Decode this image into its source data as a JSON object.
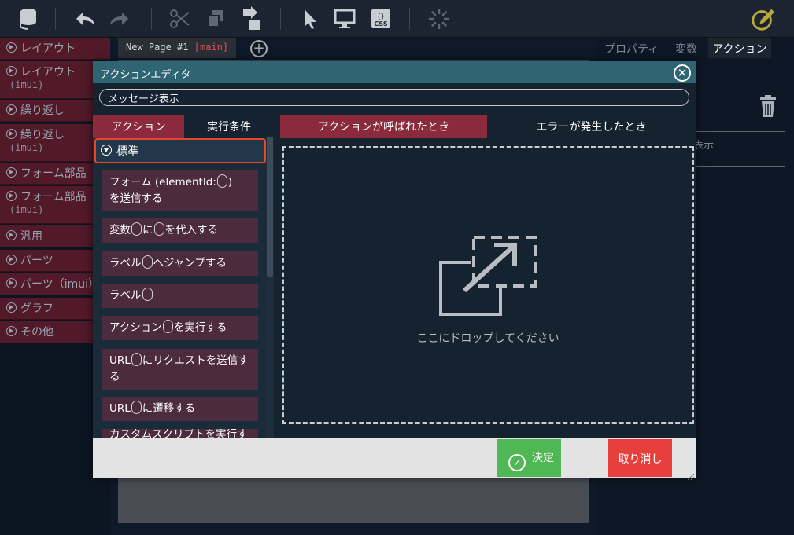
{
  "sidebar": {
    "items": [
      {
        "label": "レイアウト",
        "sub": ""
      },
      {
        "label": "レイアウト",
        "sub": "(imui)"
      },
      {
        "label": "繰り返し",
        "sub": ""
      },
      {
        "label": "繰り返し",
        "sub": "(imui)"
      },
      {
        "label": "フォーム部品",
        "sub": ""
      },
      {
        "label": "フォーム部品",
        "sub": "(imui)"
      },
      {
        "label": "汎用",
        "sub": ""
      },
      {
        "label": "パーツ",
        "sub": ""
      },
      {
        "label": "パーツ（imui）",
        "sub": ""
      },
      {
        "label": "グラフ",
        "sub": ""
      },
      {
        "label": "その他",
        "sub": ""
      }
    ]
  },
  "page_tab": {
    "name": "New Page #1",
    "branch": "[main]"
  },
  "right_panel": {
    "tabs": [
      "プロパティ",
      "変数",
      "アクション"
    ],
    "box_text": "表示"
  },
  "modal": {
    "title": "アクションエディタ",
    "name_value": "メッセージ表示",
    "left_tabs": [
      "アクション",
      "実行条件"
    ],
    "right_tabs": [
      "アクションが呼ばれたとき",
      "エラーが発生したとき"
    ],
    "group": "標準",
    "actions": [
      {
        "parts": [
          "フォーム (elementId:",
          ")"
        ],
        "line2": "を送信する"
      },
      {
        "parts": [
          "変数",
          "に",
          "を代入する"
        ],
        "line2": ""
      },
      {
        "parts": [
          "ラベル",
          "へジャンプする"
        ],
        "line2": ""
      },
      {
        "parts": [
          "ラベル",
          ""
        ],
        "line2": ""
      },
      {
        "parts": [
          "アクション",
          "を実行する"
        ],
        "line2": ""
      },
      {
        "parts": [
          "URL",
          "にリクエストを送信す"
        ],
        "line2": "る"
      },
      {
        "parts": [
          "URL",
          "に遷移する"
        ],
        "line2": ""
      },
      {
        "parts": [
          "カスタムスクリプトを実行す"
        ],
        "line2": ""
      }
    ],
    "drop_text": "ここにドロップしてください",
    "ok_label": "決定",
    "cancel_label": "取り消し"
  },
  "colors": {
    "accent_teal": "#2f6472",
    "active_tab": "#8b2a3c",
    "ok": "#4fb855",
    "cancel": "#e7403c",
    "highlight": "#e5472b"
  }
}
